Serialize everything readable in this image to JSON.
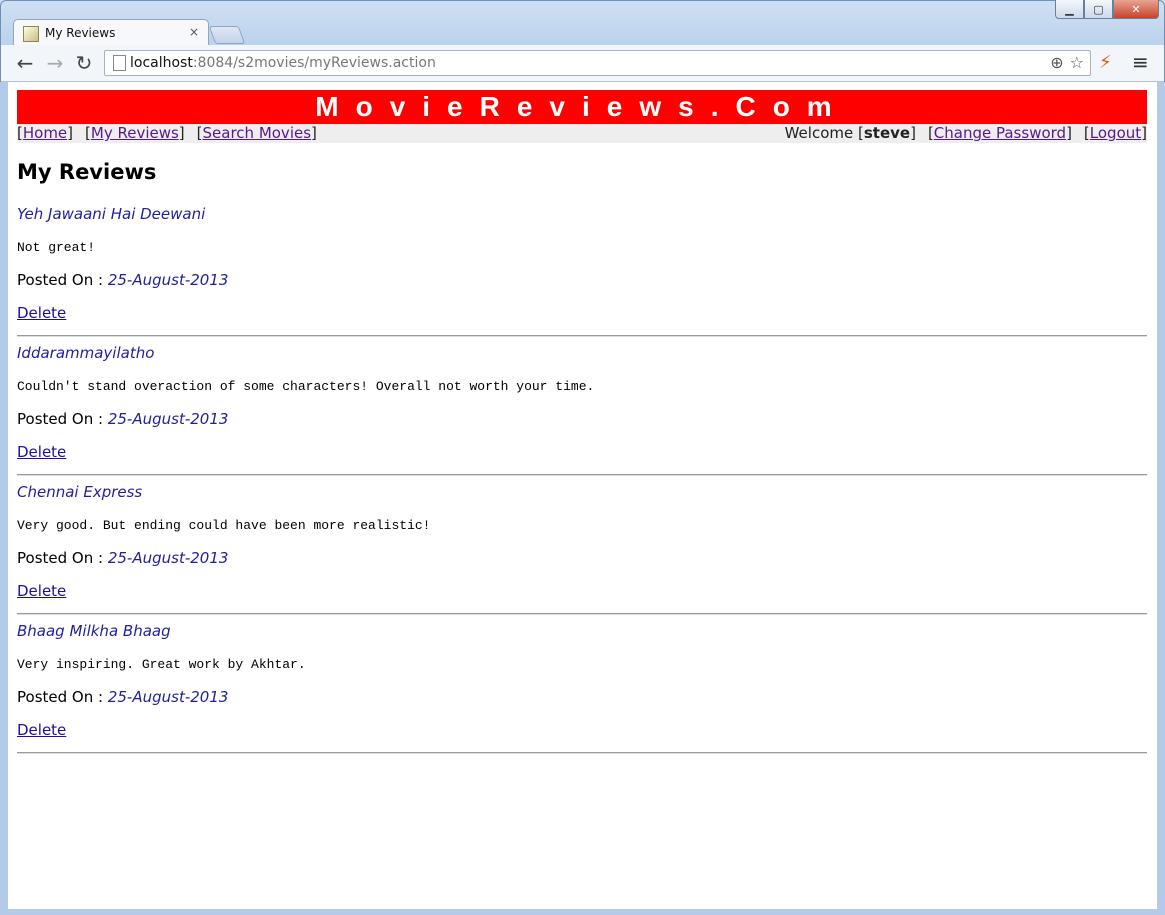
{
  "browser": {
    "tab_title": "My Reviews",
    "url_host": "localhost",
    "url_rest": ":8084/s2movies/myReviews.action"
  },
  "site": {
    "banner": "MovieReviews.Com",
    "nav": {
      "home": "Home",
      "my_reviews": "My Reviews",
      "search_movies": "Search Movies",
      "welcome_prefix": "Welcome",
      "username": "steve",
      "change_password": "Change Password",
      "logout": "Logout"
    },
    "page_title": "My Reviews"
  },
  "labels": {
    "posted_on": "Posted On :",
    "delete": "Delete"
  },
  "reviews": [
    {
      "movie": "Yeh Jawaani Hai Deewani",
      "text": "Not great!",
      "date": "25-August-2013"
    },
    {
      "movie": "Iddarammayilatho",
      "text": "Couldn't stand overaction of some characters! Overall not worth your time.",
      "date": "25-August-2013"
    },
    {
      "movie": "Chennai Express",
      "text": "Very good. But ending could have been more realistic!",
      "date": "25-August-2013"
    },
    {
      "movie": "Bhaag Milkha Bhaag",
      "text": "Very inspiring. Great work by Akhtar.",
      "date": "25-August-2013"
    }
  ]
}
